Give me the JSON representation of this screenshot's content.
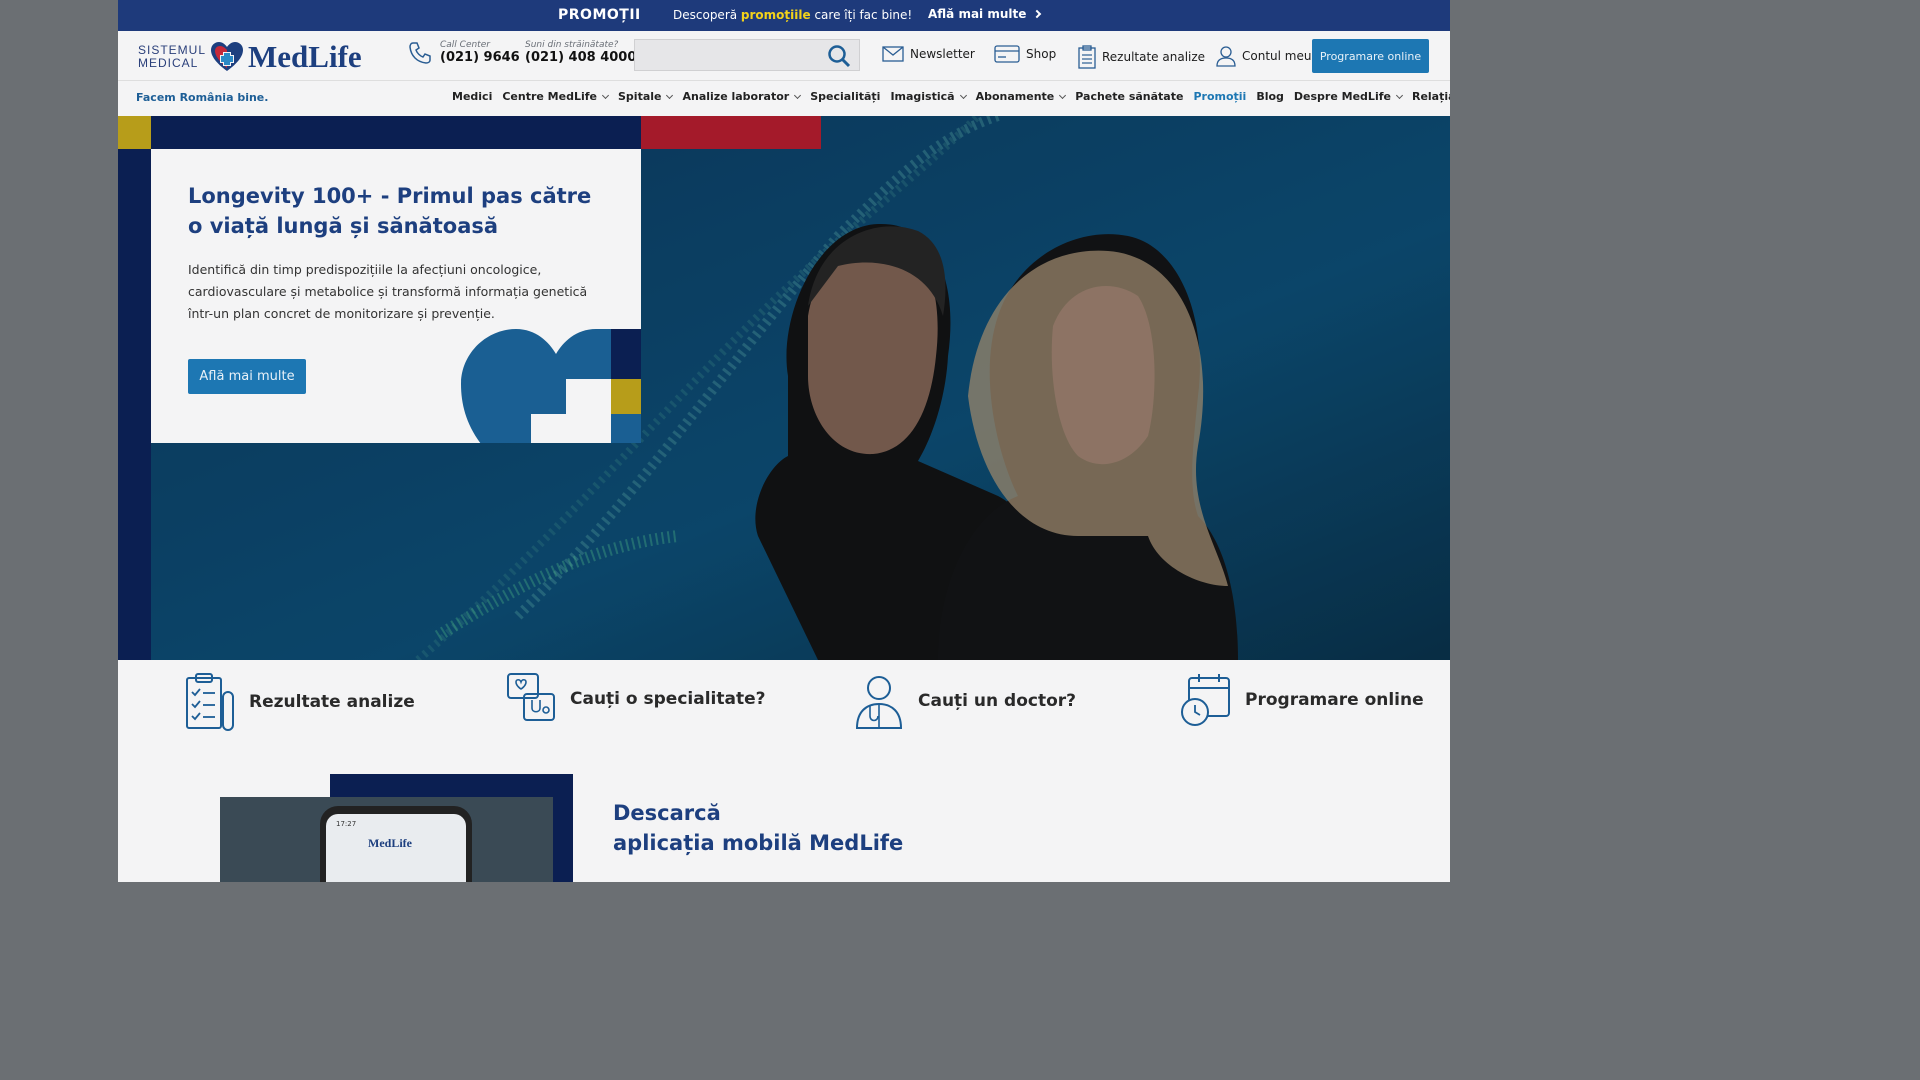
{
  "promo_bar": {
    "title": "PROMOȚII",
    "text_before": "Descoperă ",
    "text_highlight": "promoțiile",
    "text_after": " care îți fac bine!",
    "link": "Află mai multe",
    "colors": {
      "background": "#1e3a7b",
      "highlight": "#f2d21a"
    }
  },
  "header": {
    "logo": {
      "line1": "SISTEMUL",
      "line2": "MEDICAL",
      "brand": "MedLife"
    },
    "call_center": {
      "label": "Call Center",
      "number": "(021) 9646"
    },
    "abroad": {
      "label": "Suni din străinătate?",
      "number": "(021) 408 4000"
    },
    "search": {
      "placeholder": "",
      "icon": "search-icon"
    },
    "links": [
      {
        "label": "Newsletter",
        "icon": "envelope-icon"
      },
      {
        "label": "Shop",
        "icon": "card-icon"
      },
      {
        "label": "Rezultate analize",
        "icon": "clipboard-icon"
      },
      {
        "label": "Contul meu",
        "icon": "user-icon"
      }
    ],
    "cta": "Programare online"
  },
  "nav": {
    "tagline": "Facem România bine.",
    "items": [
      {
        "label": "Medici",
        "dropdown": false
      },
      {
        "label": "Centre MedLife",
        "dropdown": true
      },
      {
        "label": "Spitale",
        "dropdown": true
      },
      {
        "label": "Analize laborator",
        "dropdown": true
      },
      {
        "label": "Specialități",
        "dropdown": false
      },
      {
        "label": "Imagistică",
        "dropdown": true
      },
      {
        "label": "Abonamente",
        "dropdown": true
      },
      {
        "label": "Pachete sănătate",
        "dropdown": false
      },
      {
        "label": "Promoții",
        "dropdown": false,
        "active": true
      },
      {
        "label": "Blog",
        "dropdown": false
      },
      {
        "label": "Despre MedLife",
        "dropdown": true
      },
      {
        "label": "Relația cu investitorii",
        "dropdown": false
      }
    ]
  },
  "hero": {
    "title": "Longevity 100+ - Primul pas către o viață lungă și sănătoasă",
    "description": "Identifică din timp predispozițiile la afecțiuni oncologice, cardiovasculare și metabolice și transformă informația genetică într-un plan concret de monitorizare și prevenție.",
    "button": "Află mai multe"
  },
  "quick_links": [
    {
      "label": "Rezultate analize",
      "icon": "lab-results-icon"
    },
    {
      "label": "Cauți o specialitate?",
      "icon": "specialty-icon"
    },
    {
      "label": "Cauți un doctor?",
      "icon": "doctor-icon"
    },
    {
      "label": "Programare online",
      "icon": "calendar-clock-icon"
    }
  ],
  "app_section": {
    "title_line1": "Descarcă",
    "title_line2": "aplicația mobilă MedLife",
    "phone_time": "17:27",
    "phone_brand": "MedLife"
  }
}
